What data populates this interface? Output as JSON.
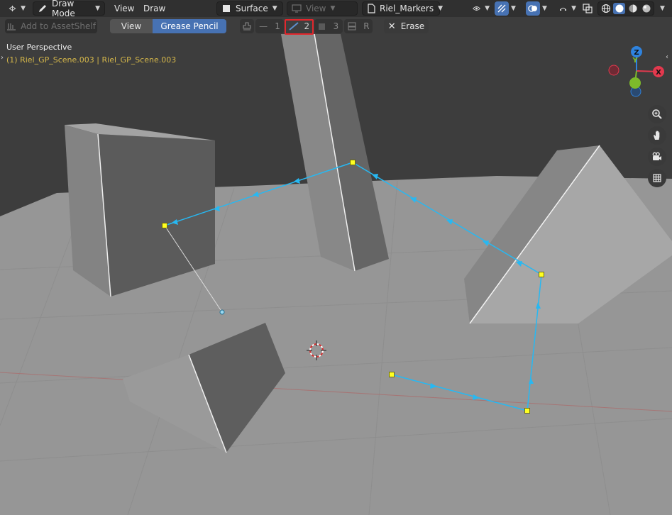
{
  "header": {
    "mode_label": "Draw Mode",
    "menu_view": "View",
    "menu_draw": "Draw",
    "surface_label": "Surface",
    "view_label": "View",
    "layer_label": "Riel_Markers"
  },
  "toolbar": {
    "add_asset_label": "Add to AssetShelf",
    "view_label": "View",
    "grease_pencil_label": "Grease Pencil",
    "slot1": "1",
    "slot2": "2",
    "slot3": "3",
    "slotR": "R",
    "erase_label": "Erase"
  },
  "viewport": {
    "perspective_label": "User Perspective",
    "object_label": "(1) Riel_GP_Scene.003",
    "object_label2": "Riel_GP_Scene.003",
    "separator": "|"
  },
  "gizmo": {
    "z_label": "Z",
    "y_label": "Y",
    "x_label": "X"
  },
  "colors": {
    "accent": "#4772b3",
    "highlight": "#e3262c",
    "stroke": "#27b8f2",
    "point": "#ffff22",
    "object_text": "#d6b84a",
    "axis_x": "#e3394e",
    "axis_y": "#7dbb2b",
    "axis_z": "#2f83de"
  }
}
